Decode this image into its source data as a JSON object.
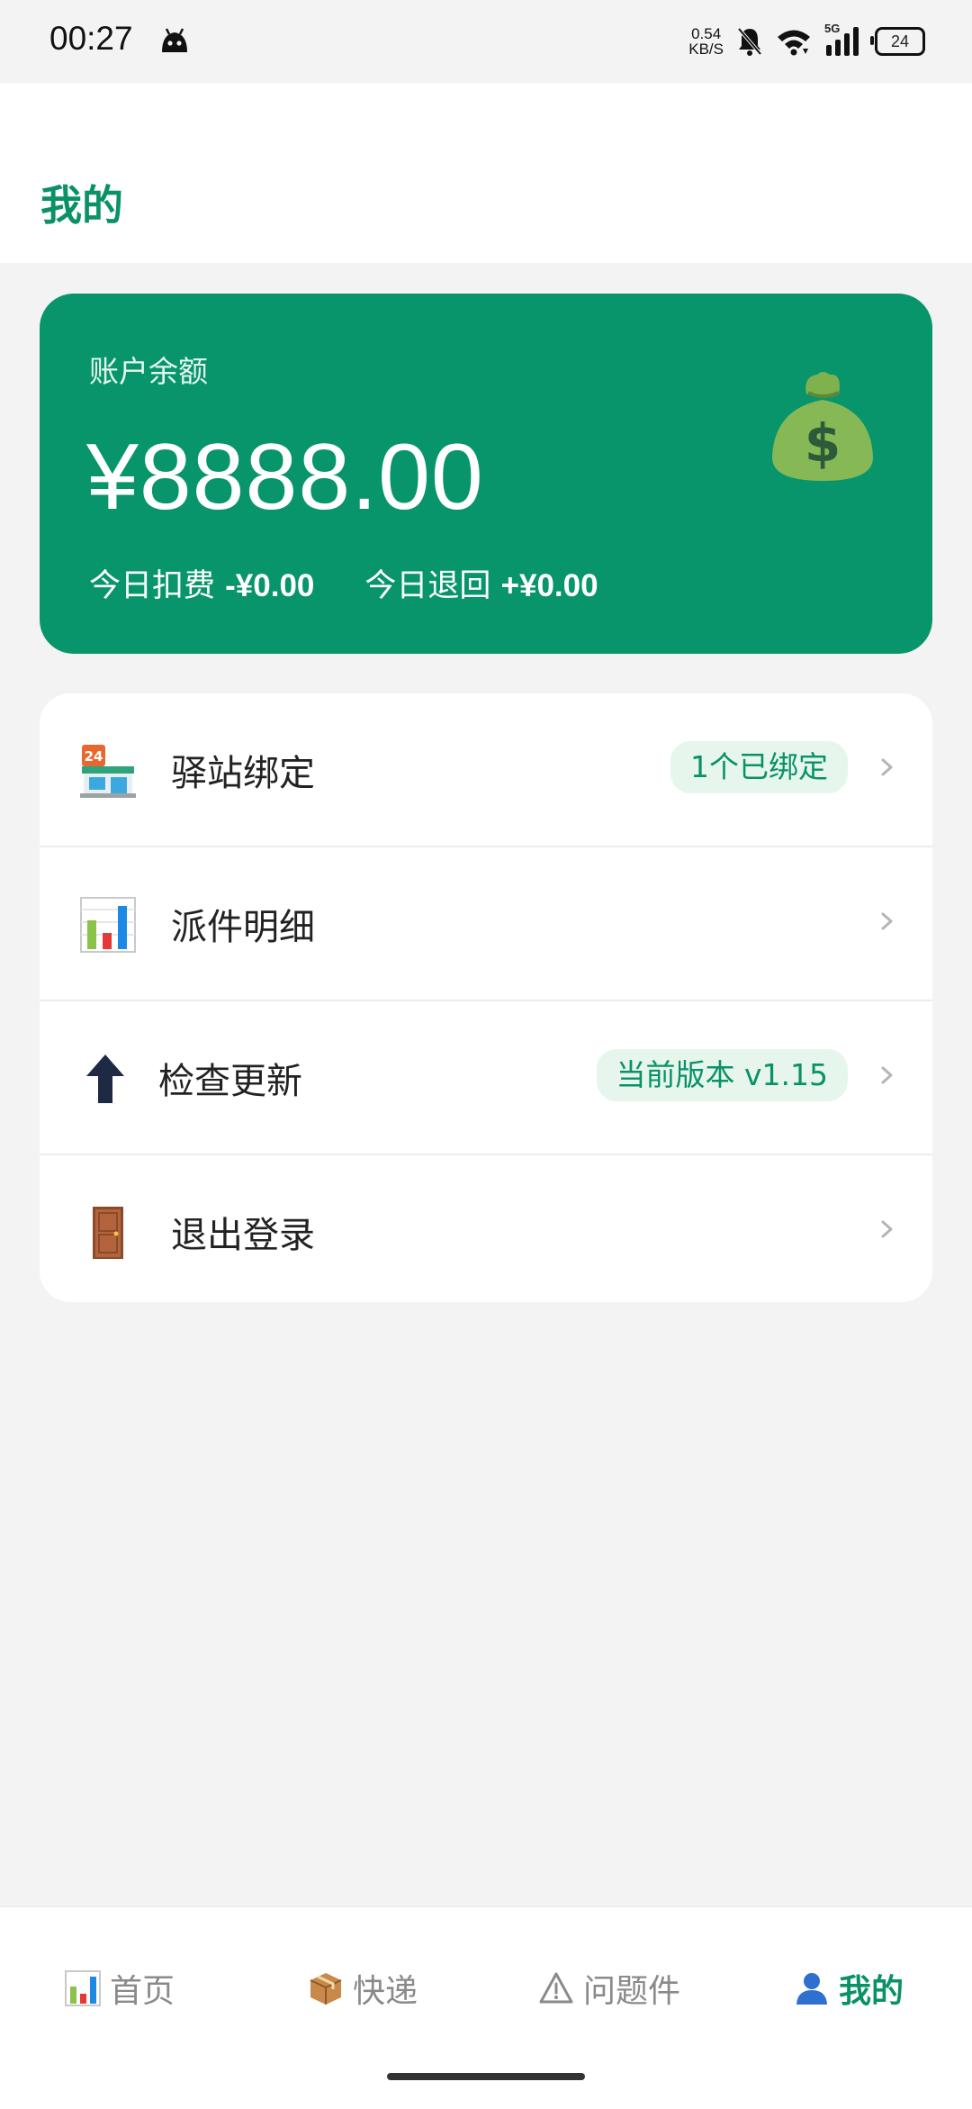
{
  "status_bar": {
    "time": "00:27",
    "net_speed_value": "0.54",
    "net_speed_unit": "KB/S",
    "signal_label": "5G",
    "battery": "24"
  },
  "header": {
    "title": "我的"
  },
  "balance": {
    "label": "账户余额",
    "amount": "¥8888.00",
    "today_deduct_label": "今日扣费",
    "today_deduct_value": "-¥0.00",
    "today_refund_label": "今日退回",
    "today_refund_value": "+¥0.00",
    "icon": "money-bag-icon"
  },
  "menu": {
    "items": [
      {
        "label": "驿站绑定",
        "badge": "1个已绑定",
        "icon": "store-24h-icon"
      },
      {
        "label": "派件明细",
        "badge": "",
        "icon": "bar-chart-icon"
      },
      {
        "label": "检查更新",
        "badge": "当前版本 v1.15",
        "icon": "up-arrow-icon"
      },
      {
        "label": "退出登录",
        "badge": "",
        "icon": "door-icon"
      }
    ]
  },
  "tabs": [
    {
      "label": "首页",
      "icon": "bar-chart-icon",
      "active": false
    },
    {
      "label": "快递",
      "icon": "package-icon",
      "active": false
    },
    {
      "label": "问题件",
      "icon": "warning-icon",
      "active": false
    },
    {
      "label": "我的",
      "icon": "user-icon",
      "active": true
    }
  ],
  "colors": {
    "primary": "#08956b",
    "primary_text": "#0a9168",
    "badge_bg": "#e6f6ed",
    "page_bg": "#f3f3f3"
  }
}
